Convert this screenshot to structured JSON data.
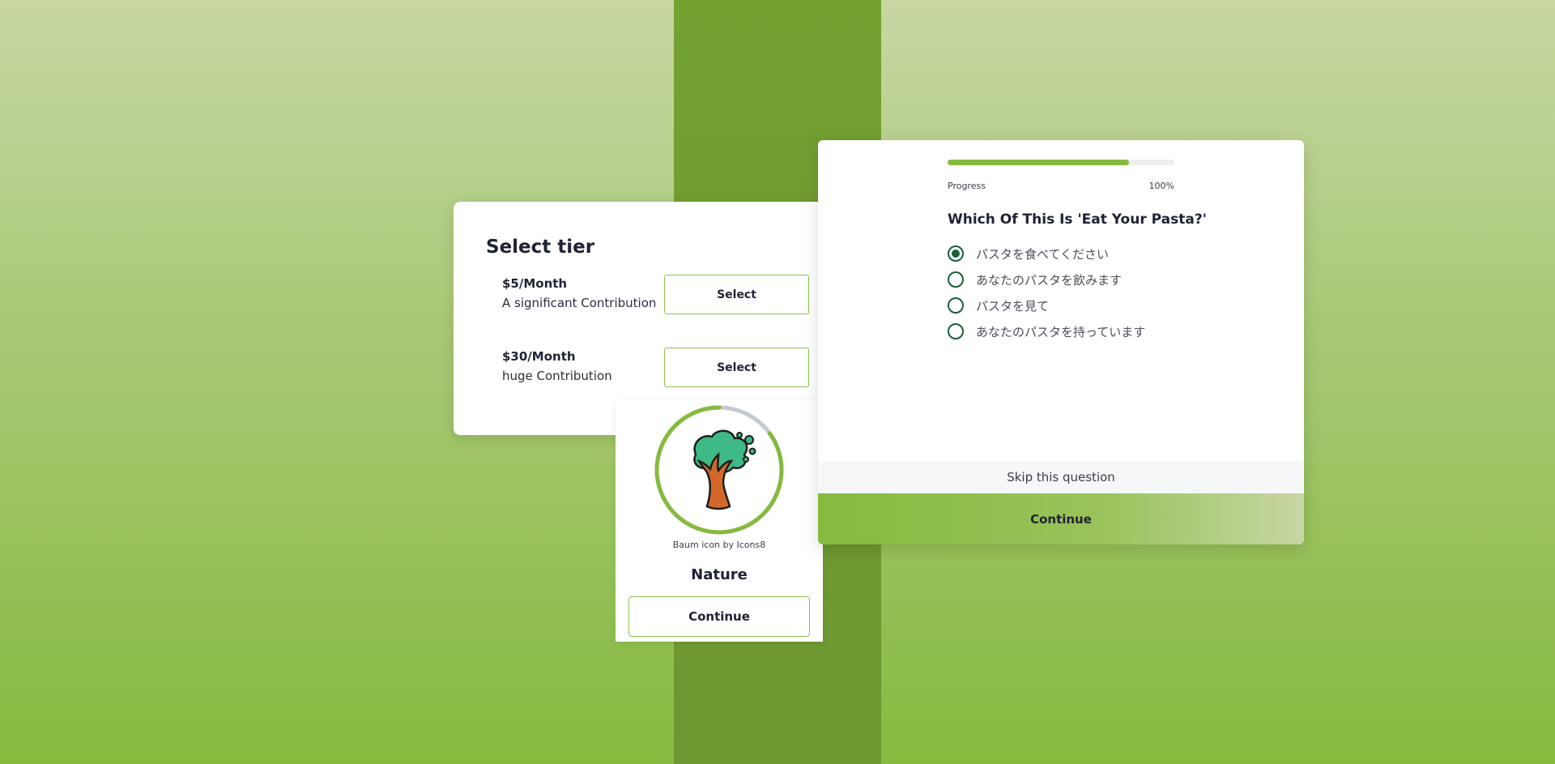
{
  "colors": {
    "accent": "#86ba3f",
    "radio": "#1b5e3a",
    "text": "#1f2235"
  },
  "tier": {
    "title": "Select tier",
    "options": [
      {
        "price": "$5/Month",
        "description": "A significant Contribution",
        "button": "Select"
      },
      {
        "price": "$30/Month",
        "description": "huge Contribution",
        "button": "Select"
      }
    ]
  },
  "badge": {
    "icon": "tree-icon",
    "credit": "Baum icon by Icons8",
    "name": "Nature",
    "ring_progress": 0.85,
    "button": "Continue"
  },
  "quiz": {
    "progress_label": "Progress",
    "progress_value": "100%",
    "progress_bar_fraction": 0.8,
    "question": "Which Of This Is 'Eat Your Pasta?'",
    "options": [
      {
        "label": "パスタを食べてください",
        "selected": true
      },
      {
        "label": "あなたのパスタを飲みます",
        "selected": false
      },
      {
        "label": "パスタを見て",
        "selected": false
      },
      {
        "label": "あなたのパスタを持っています",
        "selected": false
      }
    ],
    "skip": "Skip this question",
    "continue": "Continue"
  }
}
